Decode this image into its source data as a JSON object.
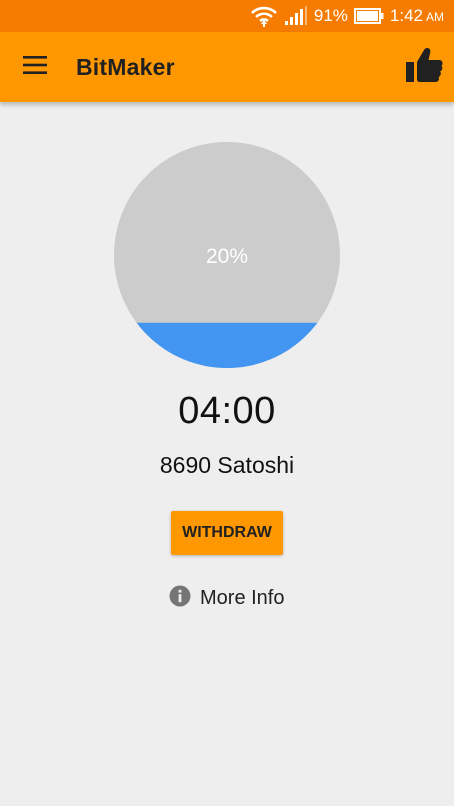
{
  "status_bar": {
    "battery_percent": "91%",
    "time": "1:42",
    "ampm": "AM",
    "icons": [
      "wifi-icon",
      "signal-icon",
      "battery-icon"
    ]
  },
  "app_bar": {
    "title": "BitMaker",
    "menu_icon": "menu-icon",
    "like_icon": "thumbs-up-icon"
  },
  "progress": {
    "label": "20%",
    "fill_fraction": 0.2
  },
  "timer": "04:00",
  "balance": "8690 Satoshi",
  "withdraw_label": "WITHDRAW",
  "more_info": {
    "label": "More Info",
    "icon": "info-icon"
  },
  "colors": {
    "status_bar": "#F57C00",
    "app_bar": "#FF9800",
    "background": "#EEEEEE",
    "circle_empty": "#CCCCCC",
    "circle_fill": "#4295F0",
    "button": "#FF9800",
    "text": "#212121"
  }
}
